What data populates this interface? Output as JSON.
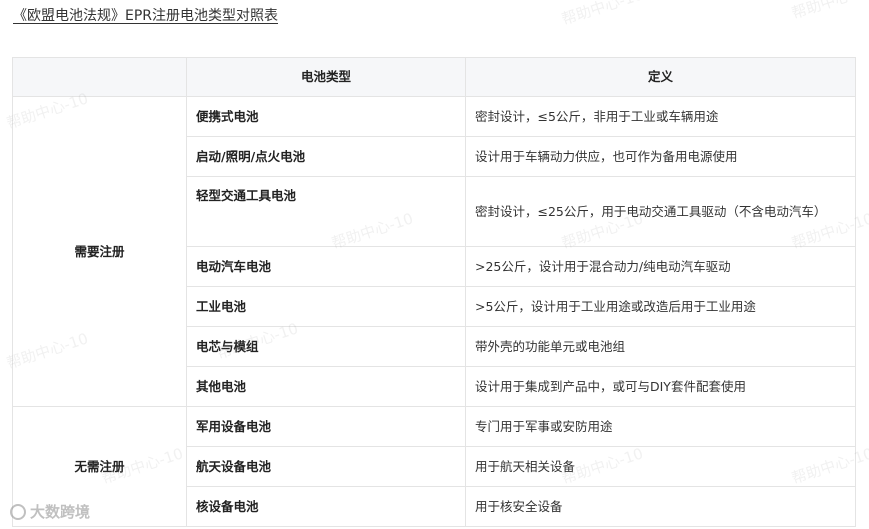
{
  "title": "《欧盟电池法规》EPR注册电池类型对照表",
  "table": {
    "headers": [
      "",
      "电池类型",
      "定义"
    ],
    "groups": [
      {
        "label": "需要注册",
        "rows": [
          {
            "type": "便携式电池",
            "definition": "密封设计，≤5公斤，非用于工业或车辆用途"
          },
          {
            "type": "启动/照明/点火电池",
            "definition": "设计用于车辆动力供应，也可作为备用电源使用"
          },
          {
            "type": "轻型交通工具电池",
            "definition": "密封设计，≤25公斤，用于电动交通工具驱动（不含电动汽车）"
          },
          {
            "type": "电动汽车电池",
            "definition": ">25公斤，设计用于混合动力/纯电动汽车驱动"
          },
          {
            "type": "工业电池",
            "definition": ">5公斤，设计用于工业用途或改造后用于工业用途"
          },
          {
            "type": "电芯与模组",
            "definition": "带外壳的功能单元或电池组"
          },
          {
            "type": "其他电池",
            "definition": "设计用于集成到产品中，或可与DIY套件配套使用"
          }
        ]
      },
      {
        "label": "无需注册",
        "rows": [
          {
            "type": "军用设备电池",
            "definition": "专门用于军事或安防用途"
          },
          {
            "type": "航天设备电池",
            "definition": "用于航天相关设备"
          },
          {
            "type": "核设备电池",
            "definition": "用于核安全设备"
          }
        ]
      }
    ]
  },
  "watermark_text": "帮助中心-10",
  "logo_text": "大数跨境"
}
